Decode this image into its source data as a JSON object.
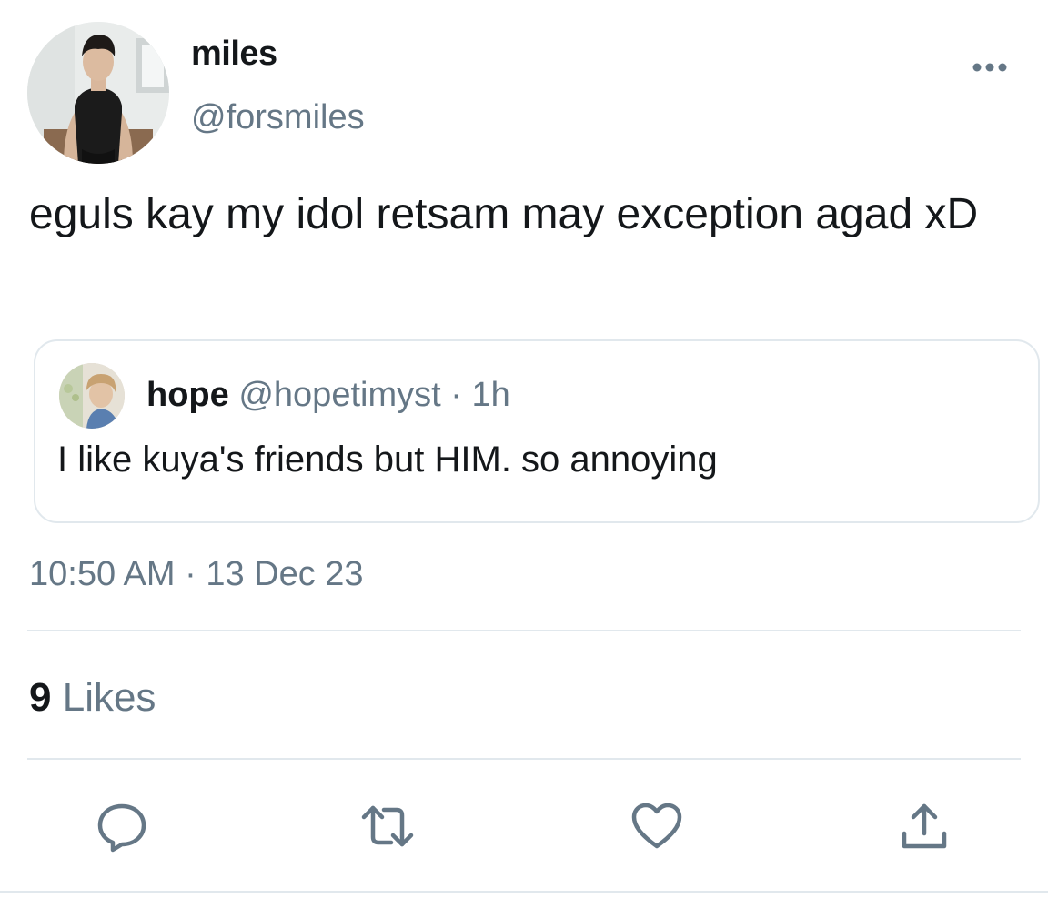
{
  "author": {
    "display_name": "miles",
    "handle": "@forsmiles"
  },
  "tweet": {
    "text": "eguls kay my idol retsam may exception agad xD"
  },
  "quoted_tweet": {
    "display_name": "hope",
    "handle": "@hopetimyst",
    "separator": "·",
    "time": "1h",
    "text": "I like kuya's friends but HIM. so annoying"
  },
  "meta": {
    "time": "10:50 AM",
    "separator": "·",
    "date": "13 Dec 23"
  },
  "stats": {
    "likes_count": "9",
    "likes_label": "Likes"
  },
  "icons": {
    "more": "more-options-icon",
    "reply": "reply-icon",
    "retweet": "retweet-icon",
    "like": "like-icon",
    "share": "share-icon"
  },
  "colors": {
    "primary_text": "#14171a",
    "secondary_text": "#657786",
    "divider": "#e1e8ed"
  }
}
